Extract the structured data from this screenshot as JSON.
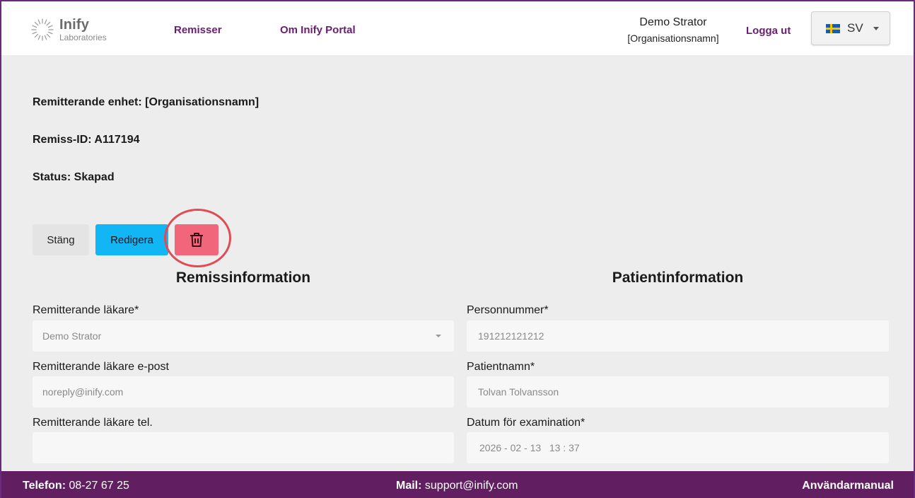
{
  "header": {
    "logo_name": "Inify",
    "logo_sub": "Laboratories",
    "nav": {
      "remisser": "Remisser",
      "om": "Om Inify Portal"
    },
    "user_name": "Demo Strator",
    "user_org": "[Organisationsnamn]",
    "logout": "Logga ut",
    "language": "SV"
  },
  "info": {
    "unit": "Remitterande enhet: [Organisationsnamn]",
    "remiss_id": "Remiss-ID: A117194",
    "status": "Status: Skapad"
  },
  "actions": {
    "close": "Stäng",
    "edit": "Redigera",
    "delete_icon": "trash-icon"
  },
  "remissinformation": {
    "title": "Remissinformation",
    "doctor_label": "Remitterande läkare*",
    "doctor_value": "Demo Strator",
    "email_label": "Remitterande läkare e-post",
    "email_value": "noreply@inify.com",
    "phone_label": "Remitterande läkare tel.",
    "phone_value": ""
  },
  "patientinformation": {
    "title": "Patientinformation",
    "pnr_label": "Personnummer*",
    "pnr_value": "191212121212",
    "name_label": "Patientnamn*",
    "name_value": "Tolvan Tolvansson",
    "date_label": "Datum för examination*",
    "date_value": "2026 - 02 - 13   13 : 37"
  },
  "footer": {
    "phone_label": "Telefon:",
    "phone_value": "08-27 67 25",
    "mail_label": "Mail:",
    "mail_value": "support@inify.com",
    "manual": "Användarmanual"
  },
  "colors": {
    "brand_purple": "#611f61",
    "edit_blue": "#12b6f4",
    "delete_pink": "#f2667c",
    "highlight_red": "#e04b54"
  }
}
